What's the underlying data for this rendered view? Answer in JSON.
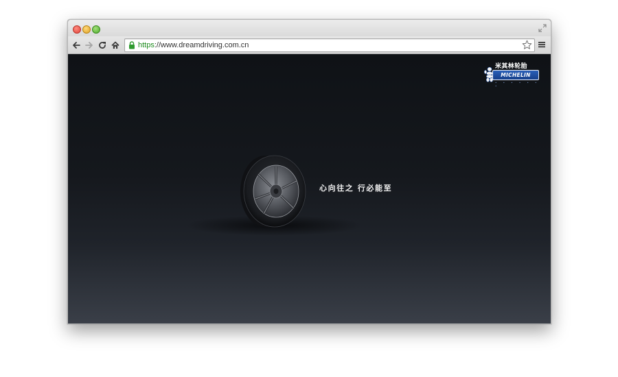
{
  "browser": {
    "url_scheme": "https",
    "url_rest": "://www.dreamdriving.com.cn",
    "icons": {
      "back": "back-arrow-icon",
      "forward": "forward-arrow-icon",
      "reload": "reload-icon",
      "home": "home-icon",
      "lock": "lock-icon",
      "bookmark": "star-icon",
      "menu": "menu-icon",
      "fullscreen": "fullscreen-icon"
    },
    "colors": {
      "secure_scheme": "#1c8a1c",
      "page_bg_top": "#0f1216",
      "page_bg_bottom": "#3a3f48"
    }
  },
  "page": {
    "slogan": "心向往之 行必能至",
    "brand_cn": "米其林轮胎",
    "brand_en": "MICHELIN",
    "brand_dots": "• • • • • • •",
    "brand_color": "#1f4fa0"
  }
}
